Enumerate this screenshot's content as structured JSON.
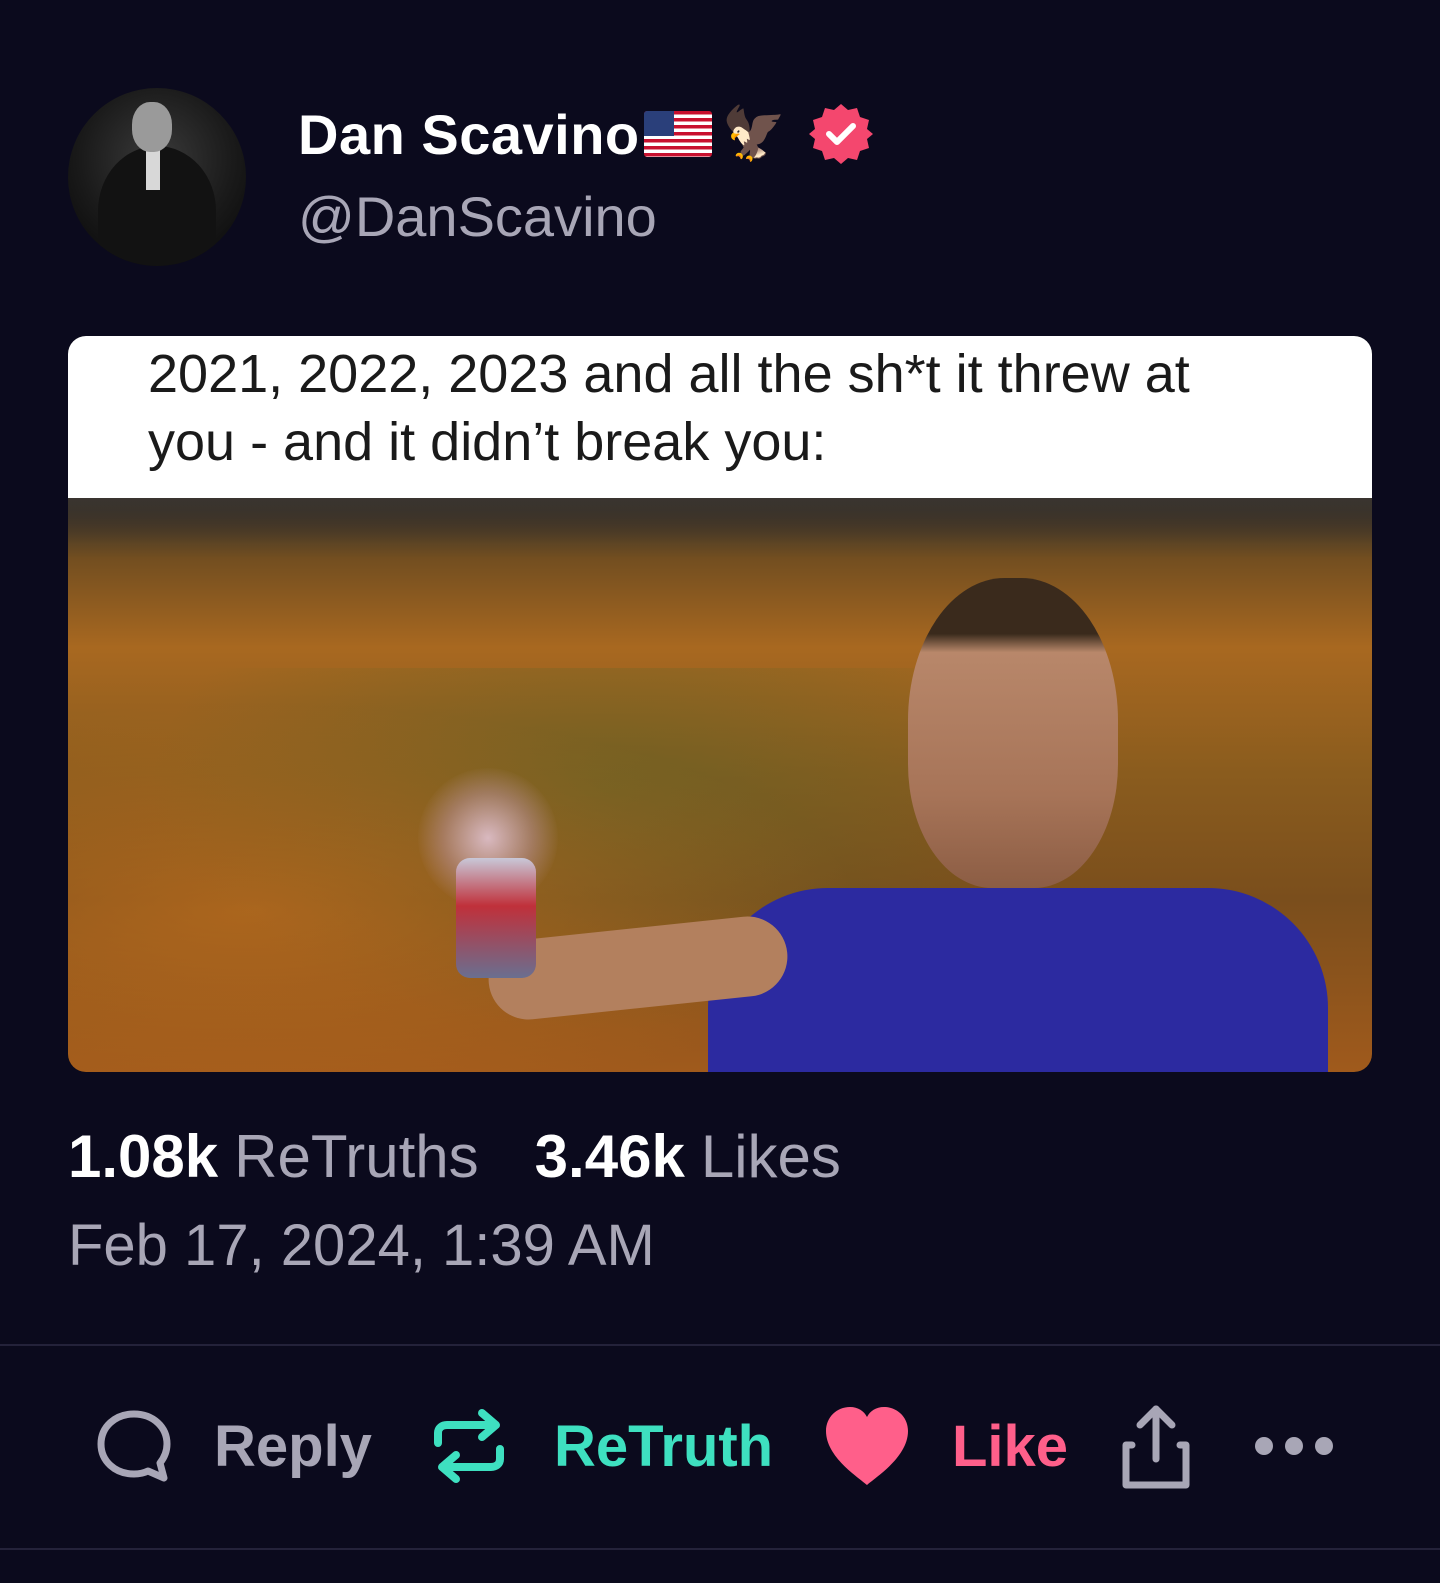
{
  "profile": {
    "display_name": "Dan Scavino",
    "handle": "@DanScavino",
    "badges": [
      "us-flag-icon",
      "eagle-icon",
      "verified-badge-icon"
    ],
    "eagle_glyph": "🦅"
  },
  "post": {
    "caption_line1": "2021, 2022, 2023 and all the sh*t it threw at",
    "caption_line2": "you - and it didn’t break you:"
  },
  "stats": {
    "retruths_count": "1.08k",
    "retruths_label": "ReTruths",
    "likes_count": "3.46k",
    "likes_label": "Likes"
  },
  "timestamp": "Feb 17, 2024, 1:39 AM",
  "actions": {
    "reply_label": "Reply",
    "retruth_label": "ReTruth",
    "like_label": "Like"
  },
  "colors": {
    "background": "#0b0a1d",
    "muted_text": "#a8a6b6",
    "retruth_accent": "#3ee0c0",
    "like_accent": "#ff5f8a",
    "verified_badge": "#f4476e"
  }
}
